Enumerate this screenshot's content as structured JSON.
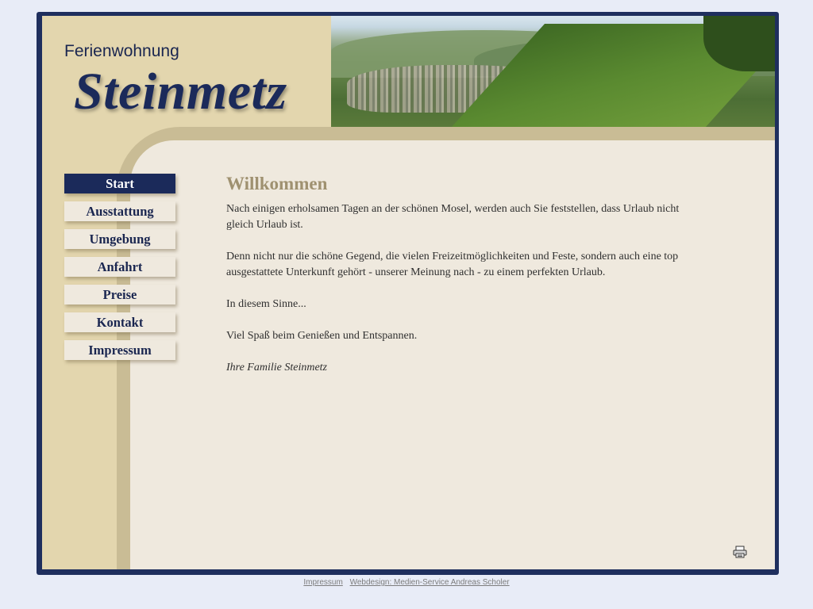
{
  "header": {
    "subtitle": "Ferienwohnung",
    "title": "Steinmetz"
  },
  "nav": {
    "items": [
      {
        "label": "Start",
        "active": true
      },
      {
        "label": "Ausstattung",
        "active": false
      },
      {
        "label": "Umgebung",
        "active": false
      },
      {
        "label": "Anfahrt",
        "active": false
      },
      {
        "label": "Preise",
        "active": false
      },
      {
        "label": "Kontakt",
        "active": false
      },
      {
        "label": "Impressum",
        "active": false
      }
    ]
  },
  "main": {
    "heading": "Willkommen",
    "paragraphs": [
      "Nach einigen erholsamen Tagen an der schönen Mosel, werden auch Sie feststellen, dass Urlaub nicht gleich Urlaub ist.",
      "Denn nicht nur die schöne Gegend, die vielen Freizeitmöglichkeiten und Feste, sondern auch eine top ausgestattete Unterkunft gehört - unserer Meinung nach - zu einem perfekten Urlaub.",
      "In diesem Sinne...",
      "Viel Spaß beim Genießen und Entspannen.",
      "Ihre Familie Steinmetz"
    ],
    "print_icon": "printer-icon"
  },
  "footer": {
    "links": [
      "Impressum",
      "Webdesign: Medien-Service Andreas Scholer"
    ]
  },
  "colors": {
    "navy": "#1b2a5a",
    "sand": "#e3d6ae",
    "content_bg": "#efe9de",
    "heading": "#9f9170",
    "page_bg": "#e8ecf7"
  }
}
